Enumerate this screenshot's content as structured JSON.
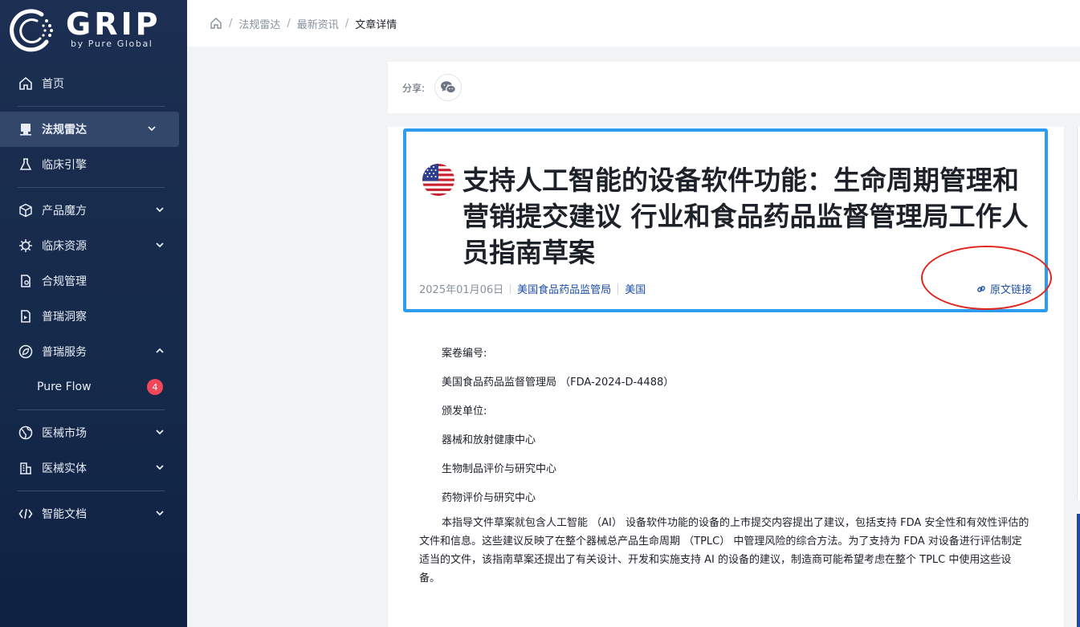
{
  "brand": {
    "name": "GRIP",
    "tagline": "by Pure Global"
  },
  "sidebar": {
    "items": [
      {
        "label": "首页",
        "icon": "home-icon"
      },
      {
        "label": "法规雷达",
        "icon": "radar-icon",
        "active": true
      },
      {
        "label": "临床引擎",
        "icon": "flask-icon"
      },
      {
        "label": "产品魔方",
        "icon": "cube-icon"
      },
      {
        "label": "临床资源",
        "icon": "virus-icon"
      },
      {
        "label": "合规管理",
        "icon": "document-icon"
      },
      {
        "label": "普瑞洞察",
        "icon": "insight-icon"
      },
      {
        "label": "普瑞服务",
        "icon": "leaf-icon"
      },
      {
        "label": "Pure Flow",
        "badge": "4"
      },
      {
        "label": "医械市场",
        "icon": "globe-icon"
      },
      {
        "label": "医械实体",
        "icon": "building-icon"
      },
      {
        "label": "智能文档",
        "icon": "code-icon"
      }
    ]
  },
  "breadcrumb": {
    "items": [
      "法规雷达",
      "最新资讯",
      "文章详情"
    ],
    "separator": "/"
  },
  "share": {
    "label": "分享:"
  },
  "article": {
    "title": "支持人工智能的设备软件功能：生命周期管理和营销提交建议 行业和食品药品监督管理局工作人员指南草案",
    "date": "2025年01月06日",
    "source": "美国食品药品监管局",
    "country": "美国",
    "original_link": "原文链接",
    "body": {
      "docket_label": "案卷编号:",
      "docket_value": "美国食品药品监督管理局 （FDA-2024-D-4488）",
      "issuer_label": "颁发单位:",
      "issuer_1": "器械和放射健康中心",
      "issuer_2": "生物制品评价与研究中心",
      "issuer_3": "药物评价与研究中心",
      "paragraph": "本指导文件草案就包含人工智能 （AI） 设备软件功能的设备的上市提交内容提出了建议，包括支持 FDA 安全性和有效性评估的文件和信息。这些建议反映了在整个器械总产品生命周期 （TPLC） 中管理风险的综合方法。为了支持为 FDA 对设备进行评估制定适当的文件，该指南草案还提出了有关设计、开发和实施支持 AI 的设备的建议，制造商可能希望考虑在整个 TPLC 中使用这些设备。"
    }
  },
  "colors": {
    "sidebar": "#1c2f52",
    "accent": "#2d9cf0",
    "link": "#1e4fa3",
    "badge": "#f0475a",
    "annotation": "#e0261d"
  }
}
